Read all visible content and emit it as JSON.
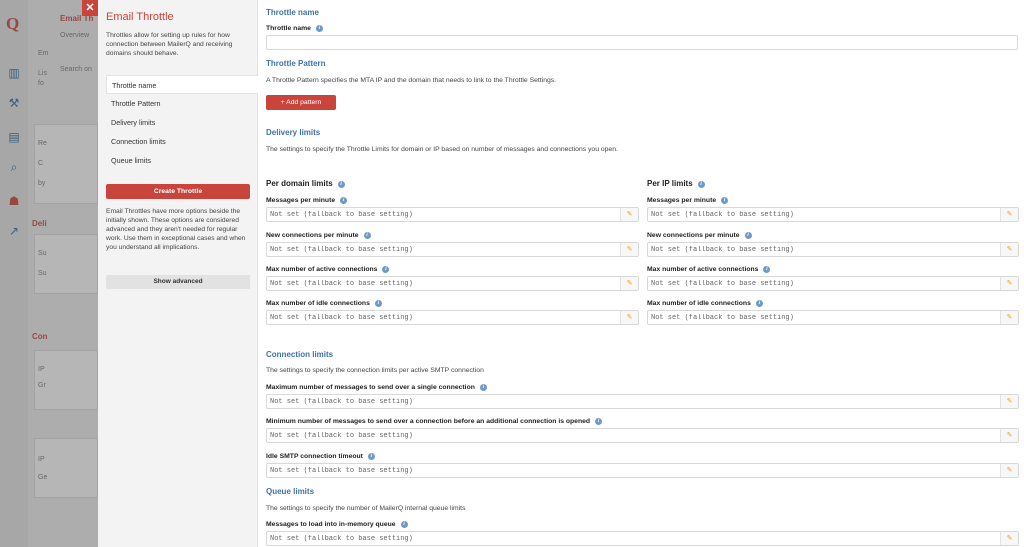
{
  "app": {
    "logo": "Q"
  },
  "background": {
    "title": "Email Th",
    "tab": "Overview",
    "search": "Search on",
    "frag_em": "Em",
    "frag_li": "Lis",
    "frag_fo": "fo",
    "frag_re": "Re",
    "frag_c": "C",
    "frag_by": "by",
    "frag_deli": "Deli",
    "frag_su1": "Su",
    "frag_su2": "Su",
    "frag_con": "Con",
    "frag_ip1": "IP",
    "frag_gr": "Gr",
    "frag_ip2": "IP",
    "frag_ge": "Ge"
  },
  "panel": {
    "close_icon": "✕",
    "title": "Email Throttle",
    "intro": "Throttles allow for setting up rules for how connection between MailerQ and receiving domains should behave.",
    "nav": [
      "Throttle name",
      "Throttle Pattern",
      "Delivery limits",
      "Connection limits",
      "Queue limits"
    ],
    "create_label": "Create Throttle",
    "advanced_text": "Email Throttles have more options beside the initially shown. These options are considered advanced and they aren't needed for regular work. Use them in exceptional cases and when you understand all implications.",
    "advanced_label": "Show advanced"
  },
  "form": {
    "name_section": "Throttle name",
    "name_label": "Throttle name",
    "pattern_section": "Throttle Pattern",
    "pattern_desc": "A Throttle Pattern specifies the MTA IP and the domain that needs to link to the Throttle Settings.",
    "add_pattern": "+ Add pattern",
    "delivery_section": "Delivery limits",
    "delivery_desc": "The settings to specify the Throttle Limits for domain or IP based on number of messages and connections you open.",
    "per_domain": "Per domain limits",
    "per_ip": "Per IP limits",
    "limit_labels": [
      "Messages per minute",
      "New connections per minute",
      "Max number of active connections",
      "Max number of idle connections"
    ],
    "placeholder": "Not set (fallback to base setting)",
    "connection_section": "Connection limits",
    "connection_desc": "The settings to specify the connection limits per active SMTP connection",
    "conn_labels": [
      "Maximum number of messages to send over a single connection",
      "Minimum number of messages to send over a connection before an additional connection is opened",
      "Idle SMTP connection timeout"
    ],
    "queue_section": "Queue limits",
    "queue_desc": "The settings to specify the number of MailerQ internal queue limits",
    "queue_labels": [
      "Messages to load into in-memory queue"
    ],
    "edit_icon": "✎",
    "info_icon": "i"
  },
  "colors": {
    "accent": "#c9443a",
    "section": "#3f72a8",
    "edit": "#e8a317"
  }
}
